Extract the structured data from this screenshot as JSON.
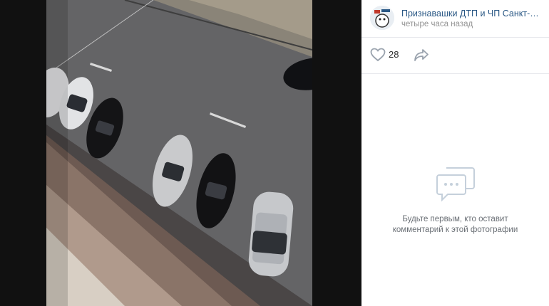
{
  "post": {
    "title": "Признавашки ДТП и ЧП Санкт-Петербург",
    "time": "четыре часа назад",
    "avatar_icon": "avatar-logo-icon"
  },
  "actions": {
    "likes": "28",
    "like_icon": "heart-icon",
    "share_icon": "share-icon"
  },
  "comments": {
    "empty_icon": "comments-bubble-icon",
    "empty_line1": "Будьте первым, кто оставит",
    "empty_line2": "комментарий к этой фотографии"
  },
  "colors": {
    "link": "#2a5885",
    "muted": "#939393",
    "icon": "#99a2ad"
  }
}
